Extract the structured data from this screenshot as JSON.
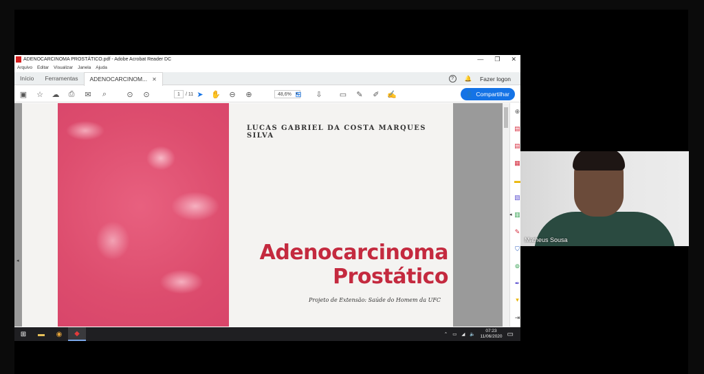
{
  "window": {
    "title": "ADENOCARCINOMA PROSTÁTICO.pdf - Adobe Acrobat Reader DC",
    "controls": [
      "—",
      "❐",
      "✕"
    ]
  },
  "menu": [
    "Arquivo",
    "Editar",
    "Visualizar",
    "Janela",
    "Ajuda"
  ],
  "tabs": {
    "home": "Início",
    "tools": "Ferramentas",
    "doc": "ADENOCARCINOM...",
    "login": "Fazer logon"
  },
  "toolbar": {
    "page_current": "1",
    "page_total": "/ 11",
    "zoom": "48,6%",
    "share": "Compartilhar"
  },
  "document": {
    "author": "LUCAS GABRIEL DA COSTA MARQUES SILVA",
    "title_line1": "Adenocarcinoma",
    "title_line2": "Prostático",
    "subtitle": "Projeto de Extensão: Saúde do Homem da UFC"
  },
  "taskbar": {
    "time": "07:23",
    "date": "11/06/2020"
  },
  "video": {
    "participant_name": "Matheus Sousa"
  },
  "colors": {
    "title_red": "#c42a3f",
    "share_blue": "#1473e6",
    "cover_pink": "#dd4d6e"
  }
}
